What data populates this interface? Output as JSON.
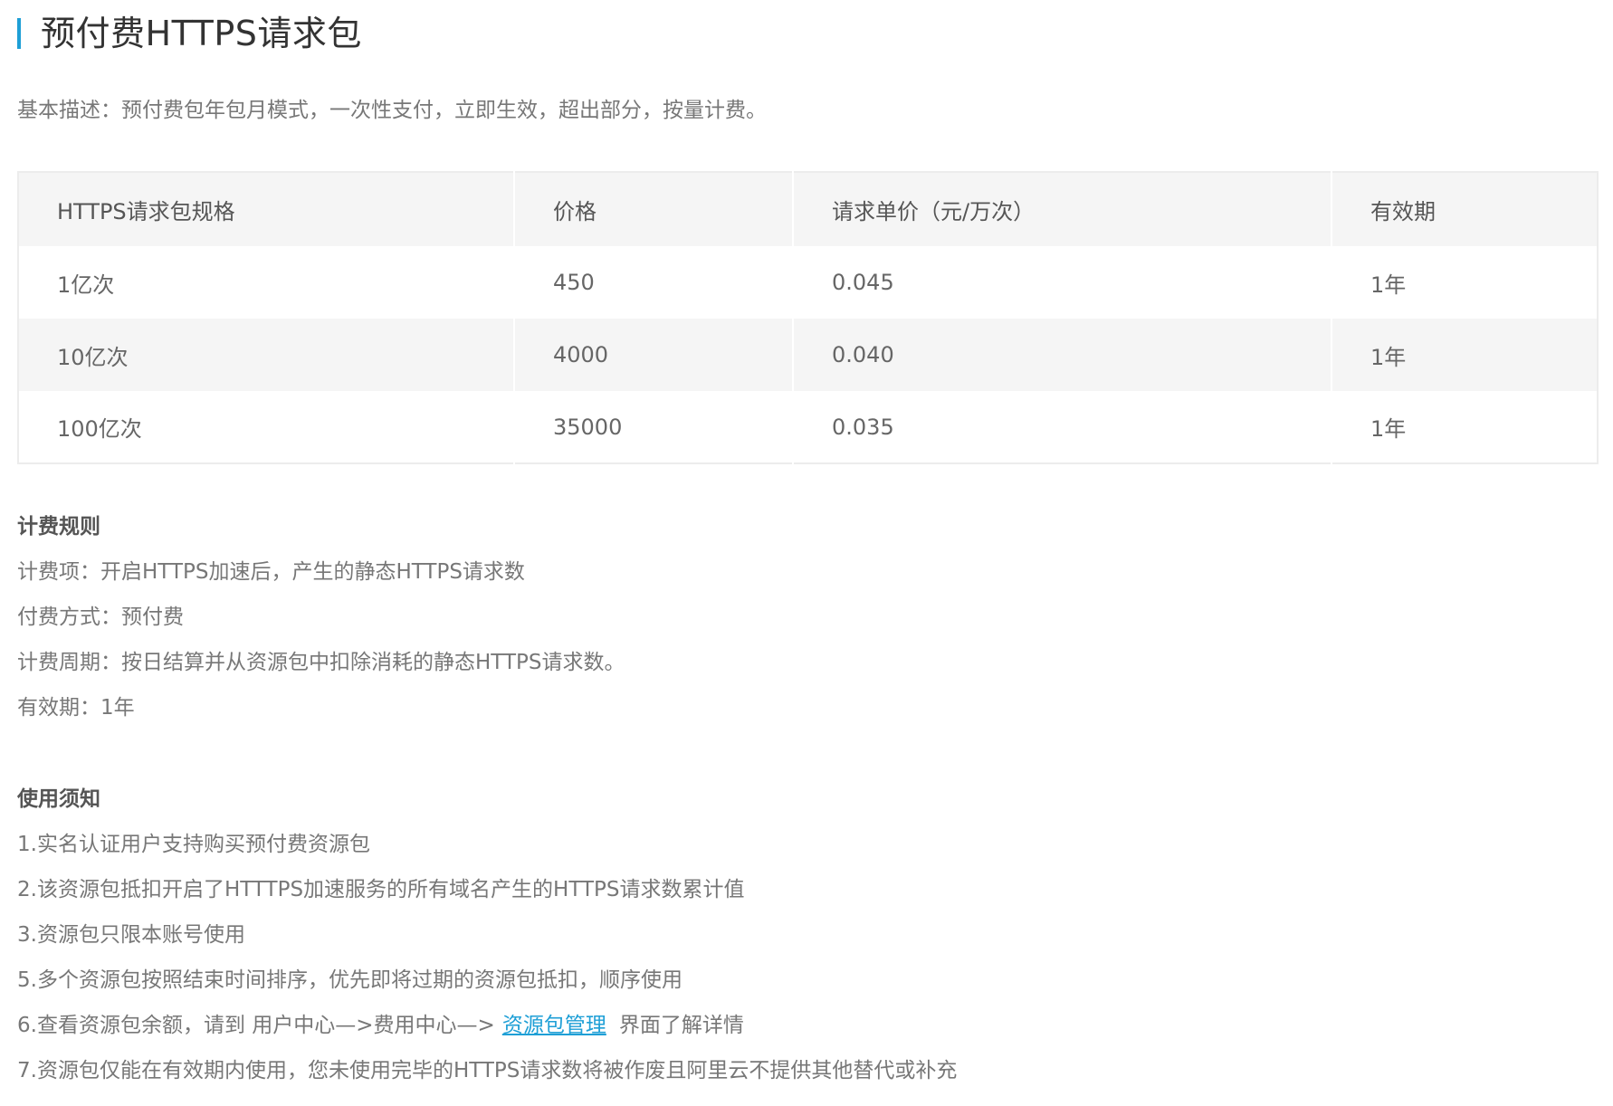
{
  "header": {
    "title": "预付费HTTPS请求包"
  },
  "description": "基本描述：预付费包年包月模式，一次性支付，立即生效，超出部分，按量计费。",
  "table": {
    "headers": [
      "HTTPS请求包规格",
      "价格",
      "请求单价（元/万次）",
      "有效期"
    ],
    "rows": [
      [
        "1亿次",
        "450",
        "0.045",
        "1年"
      ],
      [
        "10亿次",
        "4000",
        "0.040",
        "1年"
      ],
      [
        "100亿次",
        "35000",
        "0.035",
        "1年"
      ]
    ]
  },
  "billing": {
    "heading": "计费规则",
    "lines": [
      "计费项：开启HTTPS加速后，产生的静态HTTPS请求数",
      "付费方式：预付费",
      "计费周期：按日结算并从资源包中扣除消耗的静态HTTPS请求数。",
      "有效期：1年"
    ]
  },
  "notes": {
    "heading": "使用须知",
    "lines": [
      "1.实名认证用户支持购买预付费资源包",
      "2.该资源包抵扣开启了HTTTPS加速服务的所有域名产生的HTTPS请求数累计值",
      "3.资源包只限本账号使用",
      "5.多个资源包按照结束时间排序，优先即将过期的资源包抵扣，顺序使用"
    ],
    "line6": {
      "prefix": "6.查看资源包余额，请到 用户中心—>费用中心—>",
      "link": "资源包管理",
      "suffix": "界面了解详情"
    },
    "line7": "7.资源包仅能在有效期内使用，您未使用完毕的HTTPS请求数将被作废且阿里云不提供其他替代或补充"
  },
  "colors": {
    "accent": "#1e9fd6",
    "header_row_bg": "#f5f5f5",
    "text": "#666666"
  }
}
